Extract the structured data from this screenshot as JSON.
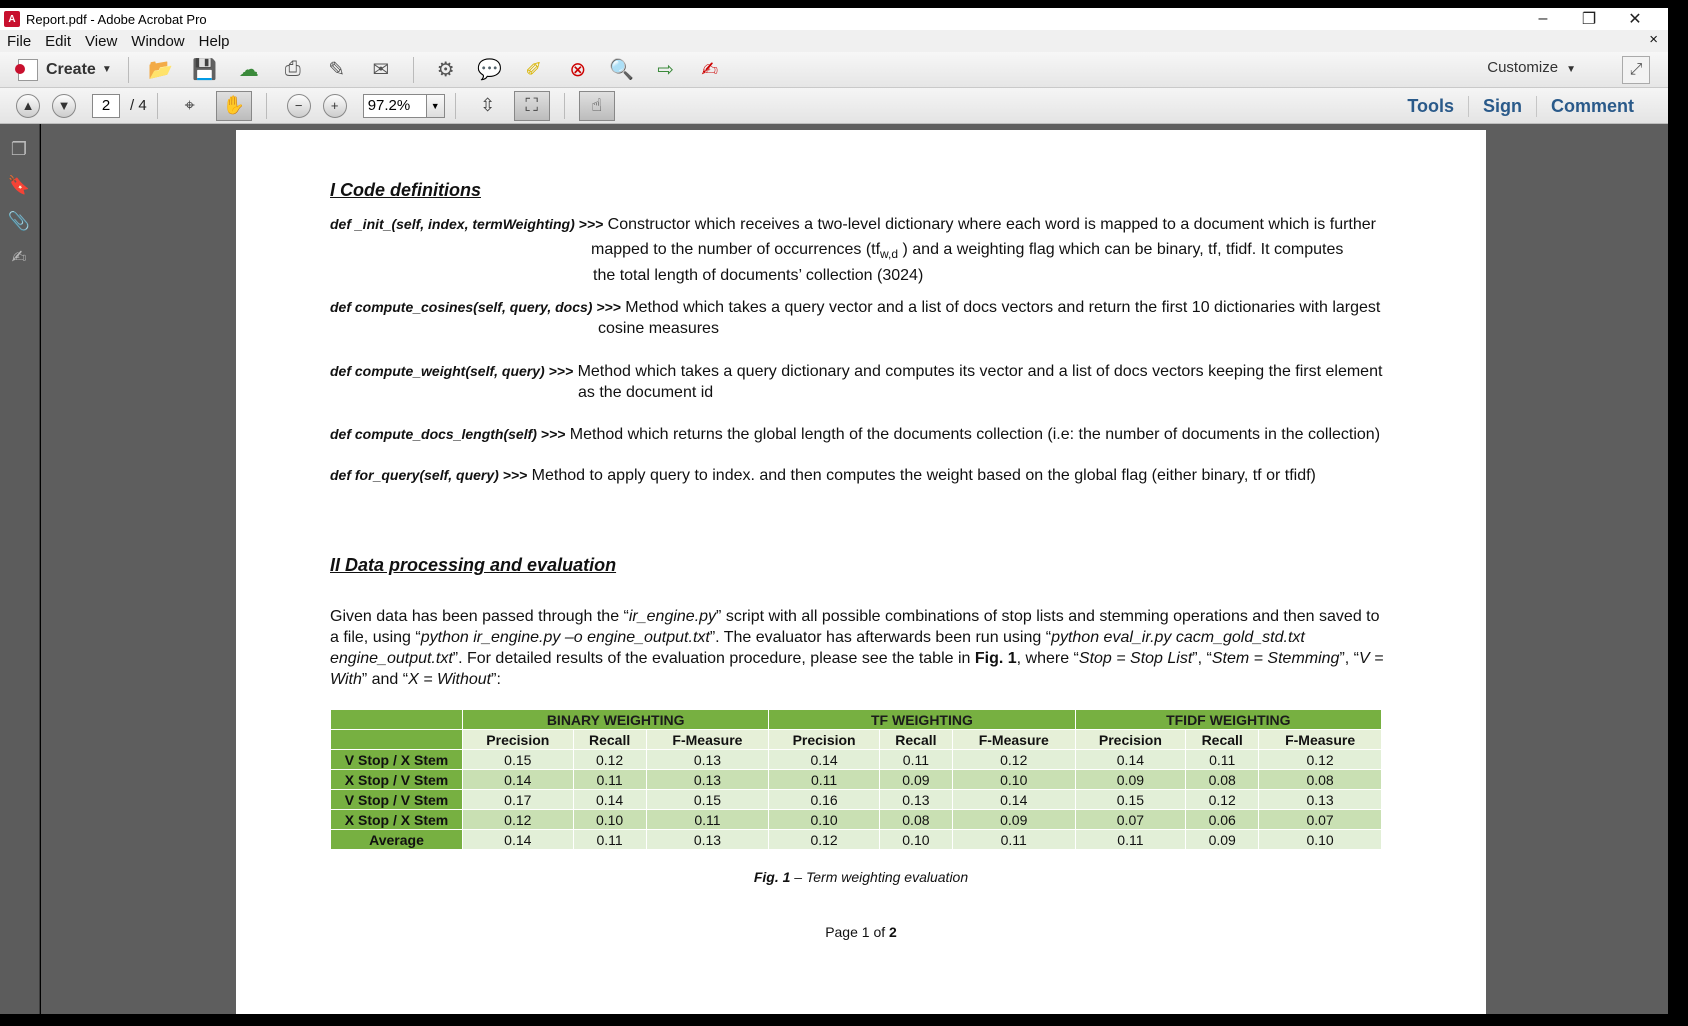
{
  "window": {
    "title": "Report.pdf - Adobe Acrobat Pro"
  },
  "menu": {
    "items": [
      "File",
      "Edit",
      "View",
      "Window",
      "Help"
    ],
    "close": "×"
  },
  "toolbar": {
    "create_label": "Create",
    "customize_label": "Customize"
  },
  "nav": {
    "page_current": "2",
    "page_total": "/ 4",
    "zoom": "97.2%"
  },
  "panels": {
    "tools": "Tools",
    "sign": "Sign",
    "comment": "Comment"
  },
  "doc": {
    "section1_title": "I Code definitions",
    "defs": [
      {
        "sig": "def _init_(self, index, termWeighting) >>>",
        "line1": " Constructor which receives a two-level dictionary where each word is mapped to a document which is further",
        "line2": "mapped to the number of occurrences (tf",
        "sub": "w,d",
        "line2b": " ) and a weighting flag which can be binary, tf, tfidf. It computes",
        "line3": "the total length of documents’ collection (3024)"
      },
      {
        "sig": "def compute_cosines(self, query, docs) >>>",
        "line1": " Method which takes a query vector and a list of docs vectors and return the first 10 dictionaries with largest",
        "line2": "cosine measures"
      },
      {
        "sig": "def compute_weight(self, query) >>>",
        "line1": " Method which takes a query dictionary and computes its vector and a list of docs vectors keeping the first element",
        "line2": "as the document id"
      },
      {
        "sig": "def compute_docs_length(self) >>>",
        "line1": " Method which returns the global length of the documents collection (i.e: the number of documents in the collection)"
      },
      {
        "sig": "def for_query(self, query) >>>",
        "line1": " Method to apply query to index. and then computes the weight based on the global flag (either binary, tf or tfidf)"
      }
    ],
    "section2_title": "II Data processing and evaluation",
    "para": {
      "p1": "Given data has been passed through the “",
      "i1": "ir_engine.py",
      "p2": "” script with all possible combinations of stop lists and stemming operations and then saved to a file, using “",
      "i2": "python ir_engine.py –o engine_output.txt",
      "p3": "”. The evaluator has afterwards been run using “",
      "i3": "python eval_ir.py cacm_gold_std.txt engine_output.txt",
      "p4": "”. For detailed results of the evaluation procedure, please see the table in ",
      "b1": "Fig. 1",
      "p5": ", where “",
      "i4": "Stop = Stop List",
      "p6": "”, “",
      "i5": "Stem = Stemming",
      "p7": "”, “",
      "i6": "V = With",
      "p8": "” and “",
      "i7": "X = Without",
      "p9": "”:"
    },
    "table": {
      "groups": [
        "BINARY WEIGHTING",
        "TF WEIGHTING",
        "TFIDF WEIGHTING"
      ],
      "subheaders": [
        "Precision",
        "Recall",
        "F-Measure",
        "Precision",
        "Recall",
        "F-Measure",
        "Precision",
        "Recall",
        "F-Measure"
      ],
      "rows": [
        {
          "label": "V Stop / X Stem",
          "cells": [
            "0.15",
            "0.12",
            "0.13",
            "0.14",
            "0.11",
            "0.12",
            "0.14",
            "0.11",
            "0.12"
          ]
        },
        {
          "label": "X Stop / V Stem",
          "cells": [
            "0.14",
            "0.11",
            "0.13",
            "0.11",
            "0.09",
            "0.10",
            "0.09",
            "0.08",
            "0.08"
          ]
        },
        {
          "label": "V Stop / V Stem",
          "cells": [
            "0.17",
            "0.14",
            "0.15",
            "0.16",
            "0.13",
            "0.14",
            "0.15",
            "0.12",
            "0.13"
          ]
        },
        {
          "label": "X Stop / X Stem",
          "cells": [
            "0.12",
            "0.10",
            "0.11",
            "0.10",
            "0.08",
            "0.09",
            "0.07",
            "0.06",
            "0.07"
          ]
        },
        {
          "label": "Average",
          "cells": [
            "0.14",
            "0.11",
            "0.13",
            "0.12",
            "0.10",
            "0.11",
            "0.11",
            "0.09",
            "0.10"
          ]
        }
      ]
    },
    "caption_bold": "Fig. 1",
    "caption_rest": " – Term weighting evaluation",
    "page_label": "Page 1 of ",
    "page_label_bold": "2"
  }
}
